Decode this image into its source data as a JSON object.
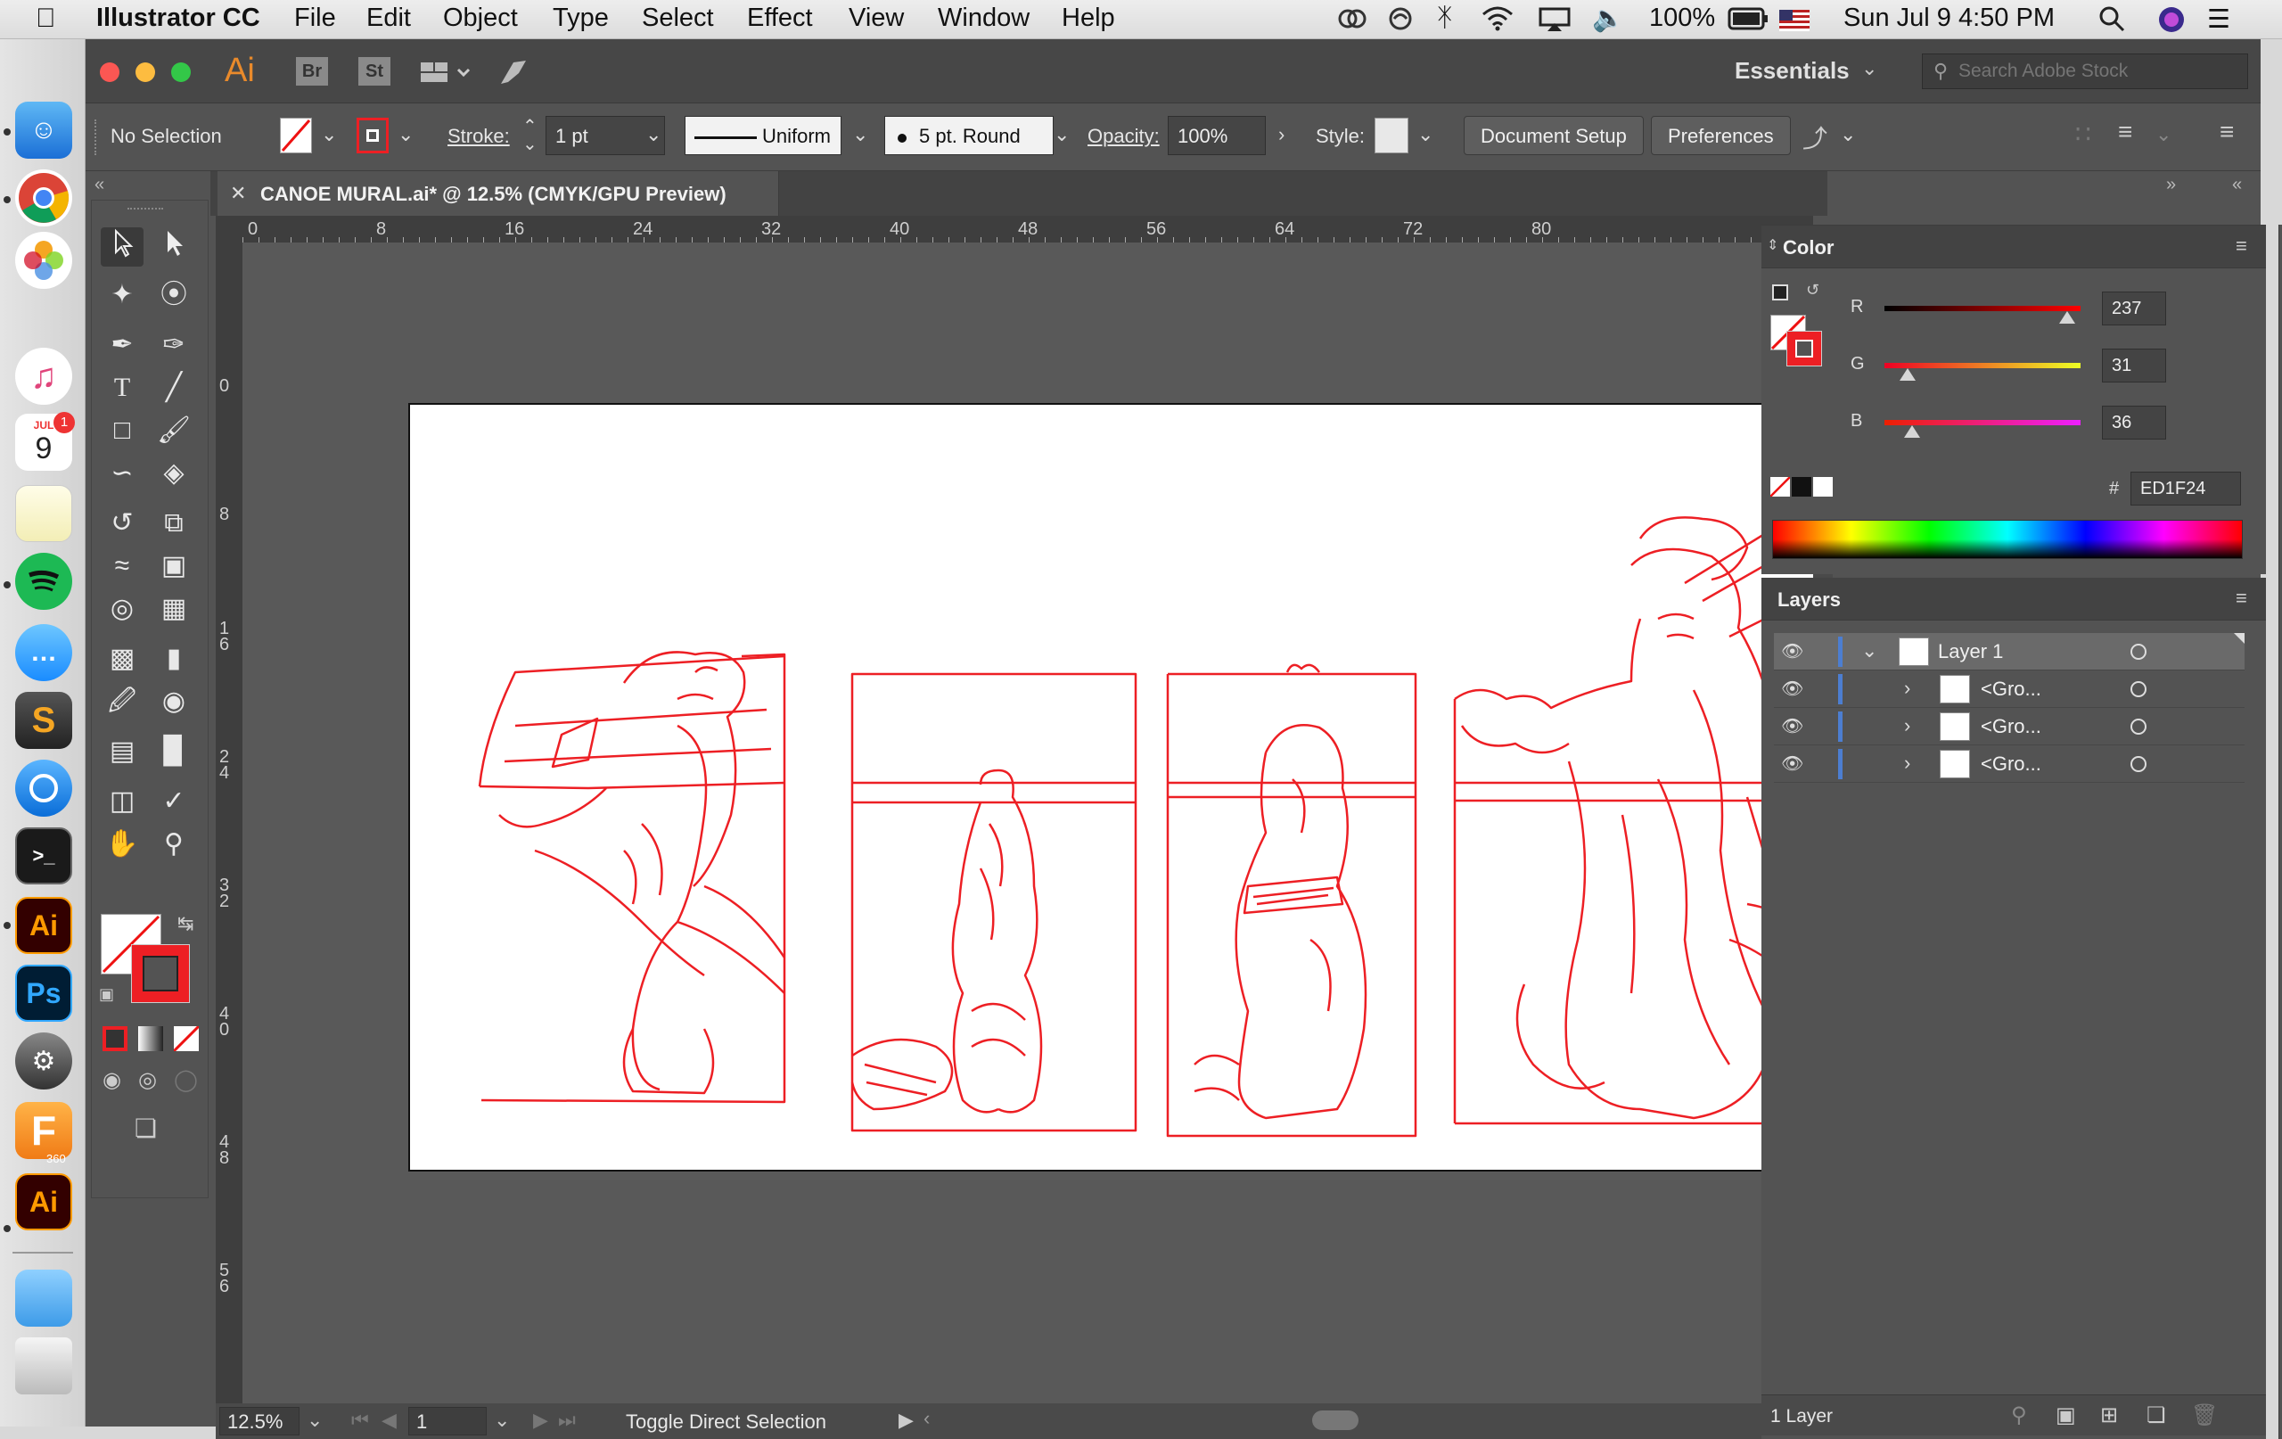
{
  "menubar": {
    "apple_icon": "apple-icon",
    "app_name": "Illustrator CC",
    "menus": [
      "File",
      "Edit",
      "Object",
      "Type",
      "Select",
      "Effect",
      "View",
      "Window",
      "Help"
    ],
    "battery": "100%",
    "datetime": "Sun Jul 9  4:50 PM"
  },
  "dock": {
    "calendar_month": "JUL",
    "calendar_day": "9",
    "calendar_badge": "1",
    "ai_label": "Ai",
    "ps_label": "Ps",
    "fusion_label": "F",
    "fusion_sub": "360",
    "ai2_label": "Ai"
  },
  "titlebar": {
    "app_logo": "Ai",
    "bridge": "Br",
    "stock": "St",
    "workspace": "Essentials",
    "search_placeholder": "Search Adobe Stock"
  },
  "control": {
    "selection": "No Selection",
    "stroke_label": "Stroke:",
    "stroke_weight": "1 pt",
    "profile": "Uniform",
    "brush": "5 pt. Round",
    "opacity_label": "Opacity:",
    "opacity": "100%",
    "style_label": "Style:",
    "doc_setup": "Document Setup",
    "preferences": "Preferences"
  },
  "document": {
    "tab_title": "CANOE MURAL.ai* @ 12.5% (CMYK/GPU Preview)",
    "ruler_top": [
      "0",
      "8",
      "16",
      "24",
      "32",
      "40",
      "48",
      "56",
      "64",
      "72",
      "80"
    ],
    "ruler_left": [
      "0",
      "8",
      "16",
      "24",
      "32",
      "40",
      "48",
      "56"
    ]
  },
  "statusbar": {
    "zoom": "12.5%",
    "artboard_num": "1",
    "tool_hint": "Toggle Direct Selection"
  },
  "color_panel": {
    "title": "Color",
    "r_label": "R",
    "r_value": "237",
    "r_fraction": 0.93,
    "g_label": "G",
    "g_value": "31",
    "g_fraction": 0.12,
    "b_label": "B",
    "b_value": "36",
    "b_fraction": 0.14,
    "hex_label": "#",
    "hex_value": "ED1F24",
    "stroke_color": "#ed1f24"
  },
  "layers_panel": {
    "title": "Layers",
    "layers": [
      {
        "name": "Layer 1"
      },
      {
        "name": "<Gro..."
      },
      {
        "name": "<Gro..."
      },
      {
        "name": "<Gro..."
      }
    ],
    "footer": "1 Layer"
  }
}
